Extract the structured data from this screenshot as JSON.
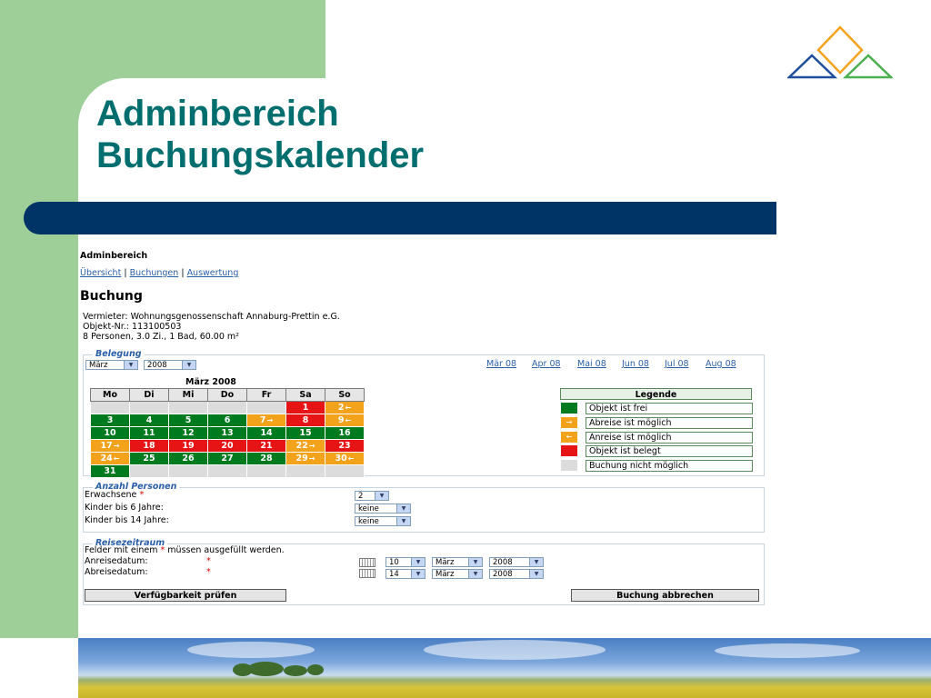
{
  "slide": {
    "title_line1": "Adminbereich",
    "title_line2": "Buchungskalender",
    "colors": {
      "accent_green": "#9fcf98",
      "navy_bar": "#003366",
      "title": "#006e6e"
    }
  },
  "app": {
    "section": "Adminbereich",
    "nav": [
      "Übersicht",
      "Buchungen",
      "Auswertung"
    ],
    "nav_sep": "|",
    "heading": "Buchung",
    "info": {
      "landlord": "Vermieter:  Wohnungsgenossenschaft Annaburg-Prettin e.G.",
      "object_nr": "Objekt-Nr.: 113100503",
      "details": "8 Personen, 3.0 Zi., 1 Bad, 60.00 m²"
    },
    "belegung": {
      "legend": "Belegung",
      "month_select": "März",
      "year_select": "2008",
      "month_links": [
        "Mär 08",
        "Apr 08",
        "Mai 08",
        "Jun 08",
        "Jul 08",
        "Aug 08"
      ],
      "calendar": {
        "title": "März 2008",
        "weekdays": [
          "Mo",
          "Di",
          "Mi",
          "Do",
          "Fr",
          "Sa",
          "So"
        ],
        "weeks": [
          [
            {
              "d": "",
              "s": "gr"
            },
            {
              "d": "",
              "s": "gr"
            },
            {
              "d": "",
              "s": "gr"
            },
            {
              "d": "",
              "s": "gr"
            },
            {
              "d": "",
              "s": "gr"
            },
            {
              "d": "1",
              "s": "r"
            },
            {
              "d": "2",
              "s": "o",
              "a": "←"
            }
          ],
          [
            {
              "d": "3",
              "s": "g"
            },
            {
              "d": "4",
              "s": "g"
            },
            {
              "d": "5",
              "s": "g"
            },
            {
              "d": "6",
              "s": "g"
            },
            {
              "d": "7",
              "s": "o",
              "a": "→"
            },
            {
              "d": "8",
              "s": "r"
            },
            {
              "d": "9",
              "s": "o",
              "a": "←"
            }
          ],
          [
            {
              "d": "10",
              "s": "g"
            },
            {
              "d": "11",
              "s": "g"
            },
            {
              "d": "12",
              "s": "g"
            },
            {
              "d": "13",
              "s": "g"
            },
            {
              "d": "14",
              "s": "g"
            },
            {
              "d": "15",
              "s": "g"
            },
            {
              "d": "16",
              "s": "g"
            }
          ],
          [
            {
              "d": "17",
              "s": "o",
              "a": "→"
            },
            {
              "d": "18",
              "s": "r"
            },
            {
              "d": "19",
              "s": "r"
            },
            {
              "d": "20",
              "s": "r"
            },
            {
              "d": "21",
              "s": "r"
            },
            {
              "d": "22",
              "s": "o",
              "a": "→"
            },
            {
              "d": "23",
              "s": "r"
            }
          ],
          [
            {
              "d": "24",
              "s": "o",
              "a": "←"
            },
            {
              "d": "25",
              "s": "g"
            },
            {
              "d": "26",
              "s": "g"
            },
            {
              "d": "27",
              "s": "g"
            },
            {
              "d": "28",
              "s": "g"
            },
            {
              "d": "29",
              "s": "o",
              "a": "→"
            },
            {
              "d": "30",
              "s": "o",
              "a": "←"
            }
          ],
          [
            {
              "d": "31",
              "s": "g"
            },
            {
              "d": "",
              "s": "gr"
            },
            {
              "d": "",
              "s": "gr"
            },
            {
              "d": "",
              "s": "gr"
            },
            {
              "d": "",
              "s": "gr"
            },
            {
              "d": "",
              "s": "gr"
            },
            {
              "d": "",
              "s": "gr"
            }
          ]
        ]
      },
      "legende": {
        "title": "Legende",
        "items": [
          {
            "label": "Objekt ist frei",
            "color": "#007a1e",
            "arrow": ""
          },
          {
            "label": "Abreise ist möglich",
            "color": "#f3a21c",
            "arrow": "→"
          },
          {
            "label": "Anreise ist möglich",
            "color": "#f3a21c",
            "arrow": "←"
          },
          {
            "label": "Objekt ist belegt",
            "color": "#e61414",
            "arrow": ""
          },
          {
            "label": "Buchung nicht möglich",
            "color": "#dcdcdc",
            "arrow": ""
          }
        ]
      }
    },
    "persons": {
      "legend": "Anzahl Personen",
      "adults_label": "Erwachsene",
      "adults_value": "2",
      "kids6_label": "Kinder bis 6 Jahre:",
      "kids6_value": "keine",
      "kids14_label": "Kinder bis 14 Jahre:",
      "kids14_value": "keine"
    },
    "travel": {
      "legend": "Reisezeitraum",
      "note_pre": "Felder mit einem",
      "note_post": "müssen ausgefüllt werden.",
      "required_mark": "*",
      "arrival_label": "Anreisedatum:",
      "arrival": {
        "day": "10",
        "month": "März",
        "year": "2008"
      },
      "departure_label": "Abreisedatum:",
      "departure": {
        "day": "14",
        "month": "März",
        "year": "2008"
      }
    },
    "buttons": {
      "check": "Verfügbarkeit prüfen",
      "cancel": "Buchung abbrechen"
    }
  }
}
